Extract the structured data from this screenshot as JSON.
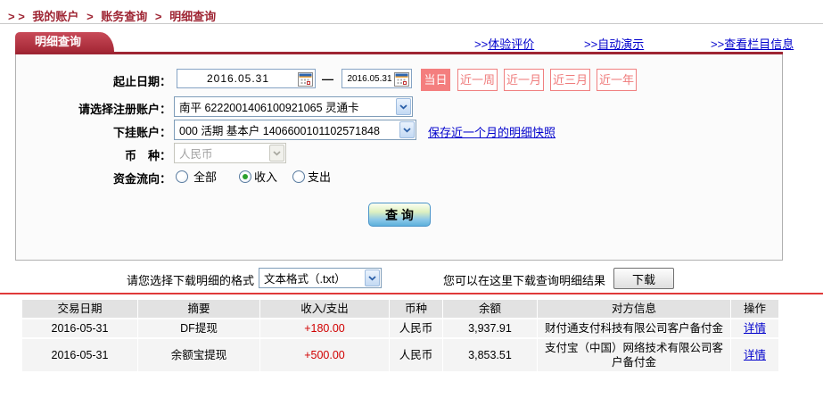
{
  "breadcrumb": {
    "prefix": "> >",
    "sep": ">",
    "items": [
      "我的账户",
      "账务查询",
      "明细查询"
    ]
  },
  "tab_label": "明细查询",
  "top_links": {
    "prefix": ">>",
    "experience": "体验评价",
    "auto_demo": "自动演示",
    "column_info": "查看栏目信息"
  },
  "form": {
    "date_label": "起止日期：",
    "date_from": "2016.05.31",
    "date_separator": "—",
    "date_to": "2016.05.31",
    "quick_ranges": {
      "today": "当日",
      "week": "近一周",
      "month": "近一月",
      "quarter": "近三月",
      "year": "近一年"
    },
    "account_label": "请选择注册账户：",
    "account_value": "南平 6222001406100921065 灵通卡",
    "sub_account_label": "下挂账户：",
    "sub_account_value": "000 活期 基本户 1406600101102571848",
    "snapshot_link": "保存近一个月的明细快照",
    "currency_label": "币　种：",
    "currency_value": "人民币",
    "flow_label": "资金流向：",
    "flow_all": "全部",
    "flow_income": "收入",
    "flow_expense": "支出",
    "query_button": "查 询"
  },
  "download": {
    "format_label": "请您选择下载明细的格式",
    "format_value": "文本格式（.txt）",
    "result_hint": "您可以在这里下载查询明细结果",
    "button_label": "下载"
  },
  "table": {
    "headers": [
      "交易日期",
      "摘要",
      "收入/支出",
      "币种",
      "余额",
      "对方信息",
      "操作"
    ],
    "rows": [
      {
        "date": "2016-05-31",
        "summary": "DF提现",
        "amount": "+180.00",
        "currency": "人民币",
        "balance": "3,937.91",
        "counterparty": "财付通支付科技有限公司客户备付金",
        "action": "详情"
      },
      {
        "date": "2016-05-31",
        "summary": "余额宝提现",
        "amount": "+500.00",
        "currency": "人民币",
        "balance": "3,853.51",
        "counterparty": "支付宝（中国）网络技术有限公司客户备付金",
        "action": "详情"
      }
    ]
  },
  "icons": {
    "calendar": "calendar-grid",
    "select_arrow": "chevron-down",
    "radio_checked": "green-dot"
  },
  "colors": {
    "brand_red": "#9e2533",
    "salmon": "#f47e7e",
    "link_blue": "#0000cc",
    "amount_red": "#d10000",
    "table_line_red": "#e03a3a"
  }
}
